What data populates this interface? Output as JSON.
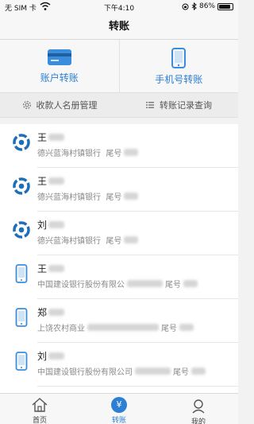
{
  "status_bar": {
    "carrier": "无 SIM 卡",
    "time": "下午4:10",
    "battery_text": "86%",
    "battery_level": 0.86
  },
  "nav": {
    "title": "转账"
  },
  "quick_actions": [
    {
      "label": "账户转账",
      "icon": "bank-card-icon"
    },
    {
      "label": "手机号转账",
      "icon": "mobile-phone-icon"
    }
  ],
  "tools": [
    {
      "label": "收款人名册管理",
      "icon": "gear-icon"
    },
    {
      "label": "转账记录查询",
      "icon": "list-icon"
    }
  ],
  "payees": [
    {
      "surname": "王",
      "bank": "德兴蓝海村镇银行",
      "tail_label": "尾号",
      "icon": "bank-logo-icon"
    },
    {
      "surname": "王",
      "bank": "德兴蓝海村镇银行",
      "tail_label": "尾号",
      "icon": "bank-logo-icon"
    },
    {
      "surname": "刘",
      "bank": "德兴蓝海村镇银行",
      "tail_label": "尾号",
      "icon": "bank-logo-icon"
    },
    {
      "surname": "王",
      "bank": "中国建设银行股份有限公",
      "tail_label": "尾号",
      "icon": "mobile-phone-icon"
    },
    {
      "surname": "郑",
      "bank": "上饶农村商业",
      "tail_label": "尾号",
      "icon": "mobile-phone-icon"
    },
    {
      "surname": "刘",
      "bank": "中国建设银行股份有限公司",
      "tail_label": "尾号",
      "icon": "mobile-phone-icon"
    }
  ],
  "tabbar": [
    {
      "label": "首页",
      "icon": "home-icon",
      "active": false
    },
    {
      "label": "转账",
      "icon": "yen-icon",
      "active": true
    },
    {
      "label": "我的",
      "icon": "user-icon",
      "active": false
    }
  ],
  "colors": {
    "accent": "#2d7fd3",
    "bank_logo": "#1f6fb8"
  },
  "yen_symbol": "¥"
}
